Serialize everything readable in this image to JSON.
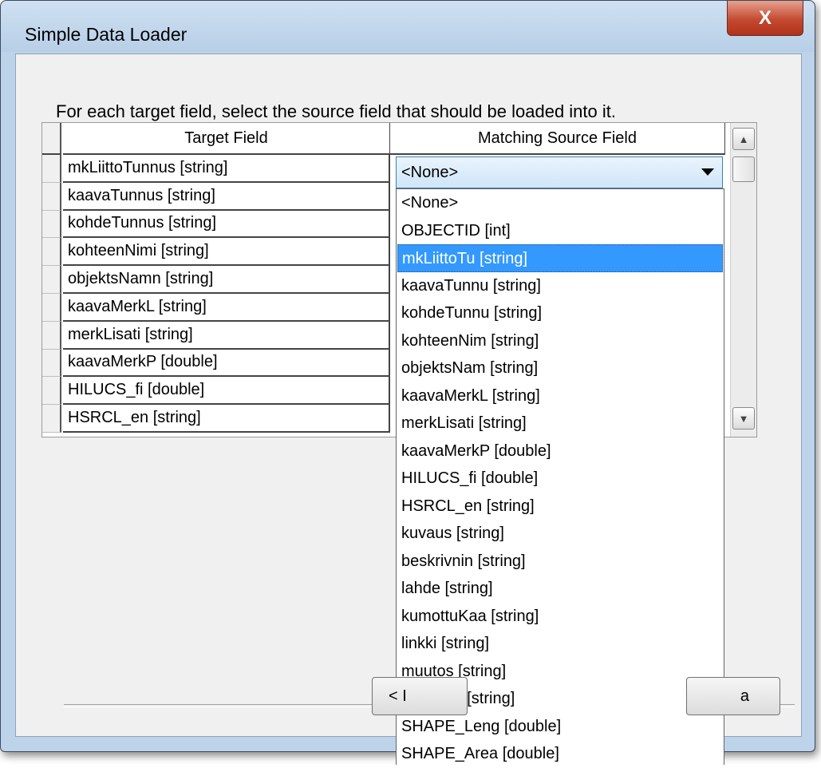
{
  "window": {
    "title": "Simple Data Loader",
    "close_label": "X"
  },
  "instruction": "For each target field, select the source field that should be loaded into it.",
  "grid": {
    "headers": {
      "target": "Target Field",
      "source": "Matching Source Field"
    },
    "target_rows": [
      "mkLiittoTunnus [string]",
      "kaavaTunnus [string]",
      "kohdeTunnus [string]",
      "kohteenNimi [string]",
      "objektsNamn [string]",
      "kaavaMerkL [string]",
      "merkLisati [string]",
      "kaavaMerkP [double]",
      "HILUCS_fi [double]",
      "HSRCL_en [string]"
    ],
    "combo_value": "<None>",
    "dropdown_options": [
      "<None>",
      "OBJECTID [int]",
      "mkLiittoTu [string]",
      "kaavaTunnu [string]",
      "kohdeTunnu [string]",
      "kohteenNim [string]",
      "objektsNam [string]",
      "kaavaMerkL [string]",
      "merkLisati [string]",
      "kaavaMerkP [double]",
      "HILUCS_fi [double]",
      "HSRCL_en [string]",
      "kuvaus [string]",
      "beskrivnin [string]",
      "lahde [string]",
      "kumottuKaa [string]",
      "linkki [string]",
      "muutos [string]",
      "merkinta [string]",
      "SHAPE_Leng [double]",
      "SHAPE_Area [double]"
    ],
    "selected_option": 2
  },
  "buttons": {
    "back_visible": "< I",
    "next_visible": "a"
  }
}
